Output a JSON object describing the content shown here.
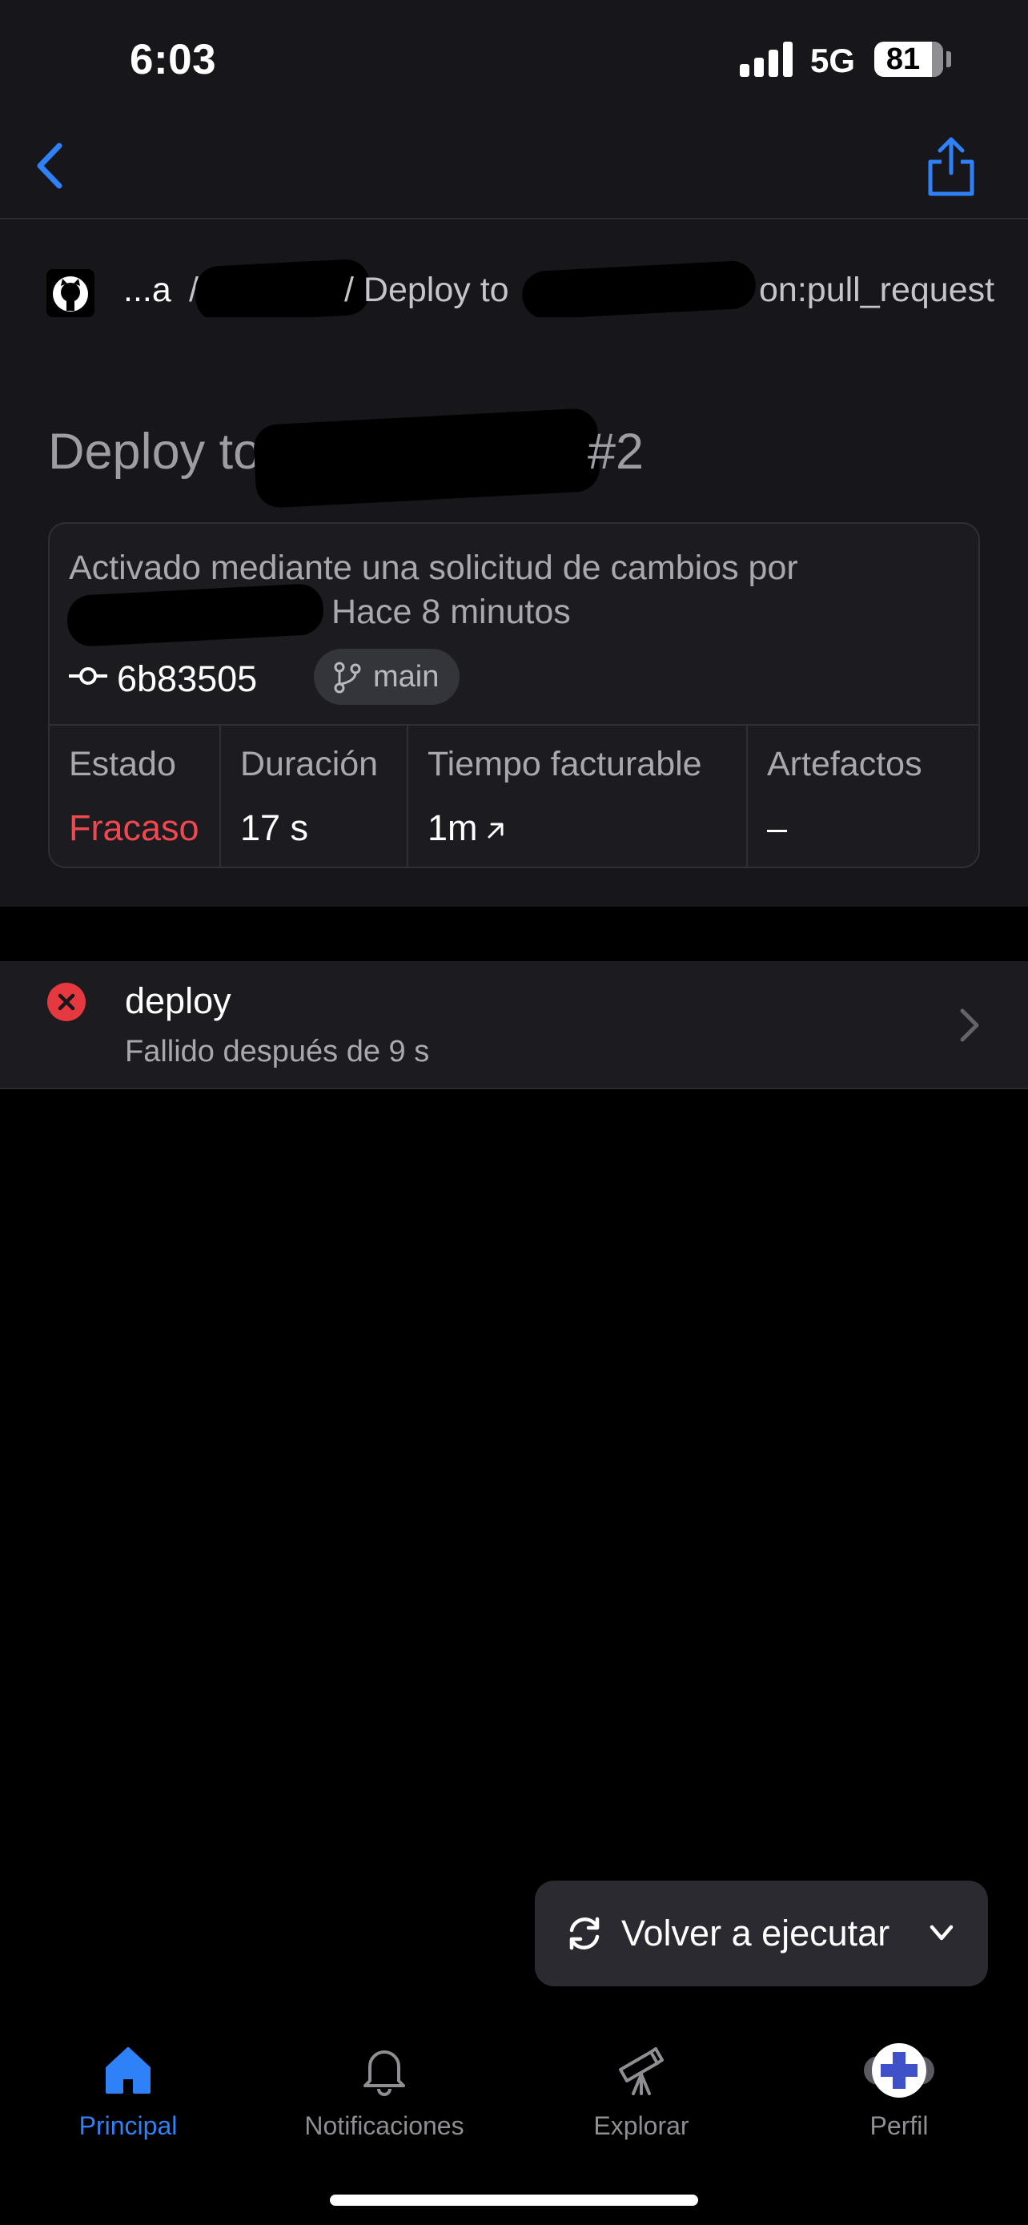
{
  "status_bar": {
    "time": "6:03",
    "network": "5G",
    "battery": "81"
  },
  "breadcrumb": {
    "owner": "...a",
    "separator": "/",
    "workflow": "/ Deploy to",
    "event": "on:pull_request"
  },
  "run": {
    "title": "Deploy to",
    "number": "#2",
    "trigger_text": "Activado mediante una solicitud de cambios por",
    "time_ago": "Hace 8 minutos",
    "commit_sha": "6b83505",
    "branch": "main",
    "stats": [
      {
        "label": "Estado",
        "value": "Fracaso"
      },
      {
        "label": "Duración",
        "value": "17 s"
      },
      {
        "label": "Tiempo facturable",
        "value": "1m"
      },
      {
        "label": "Artefactos",
        "value": "–"
      }
    ]
  },
  "jobs": [
    {
      "name": "deploy",
      "subtitle": "Fallido después de 9 s",
      "status_icon": "x-circle-icon"
    }
  ],
  "rerun": {
    "label": "Volver a ejecutar"
  },
  "tabs": [
    {
      "label": "Principal",
      "icon": "home-icon",
      "active": true
    },
    {
      "label": "Notificaciones",
      "icon": "bell-icon"
    },
    {
      "label": "Explorar",
      "icon": "telescope-icon"
    },
    {
      "label": "Perfil",
      "icon": "avatar"
    }
  ],
  "colors": {
    "accent": "#2f81f7",
    "failure": "#f0484f",
    "background": "#000000",
    "surface": "#17171b"
  }
}
